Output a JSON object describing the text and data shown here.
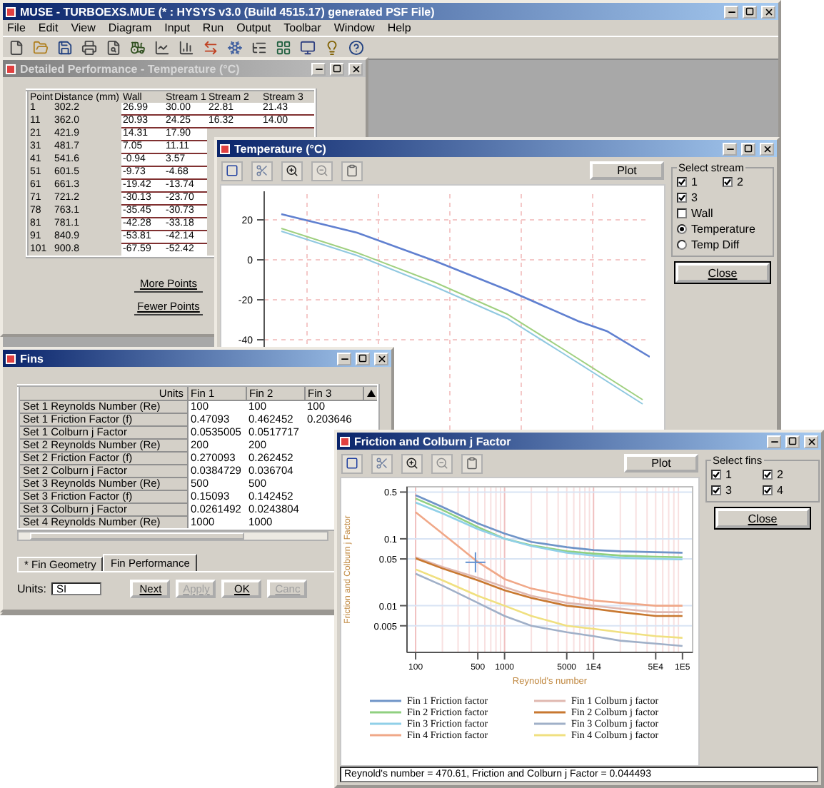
{
  "main_window": {
    "title": "MUSE - TURBOEXS.MUE (* : HYSYS v3.0 (Build 4515.17) generated PSF File)",
    "menu": [
      "File",
      "Edit",
      "View",
      "Diagram",
      "Input",
      "Run",
      "Output",
      "Toolbar",
      "Window",
      "Help"
    ]
  },
  "performance_window": {
    "title": "Detailed Performance - Temperature (°C)",
    "columns": [
      "Point",
      "Distance (mm)",
      "Wall",
      "Stream 1",
      "Stream 2",
      "Stream 3"
    ],
    "rows": [
      [
        "1",
        "302.2",
        "26.99",
        "30.00",
        "22.81",
        "21.43"
      ],
      [
        "11",
        "362.0",
        "20.93",
        "24.25",
        "16.32",
        "14.00"
      ],
      [
        "21",
        "421.9",
        "14.31",
        "17.90"
      ],
      [
        "31",
        "481.7",
        "7.05",
        "11.11"
      ],
      [
        "41",
        "541.6",
        "-0.94",
        "3.57"
      ],
      [
        "51",
        "601.5",
        "-9.73",
        "-4.68"
      ],
      [
        "61",
        "661.3",
        "-19.42",
        "-13.74"
      ],
      [
        "71",
        "721.2",
        "-30.13",
        "-23.70"
      ],
      [
        "78",
        "763.1",
        "-35.45",
        "-30.73"
      ],
      [
        "81",
        "781.1",
        "-42.28",
        "-33.18"
      ],
      [
        "91",
        "840.9",
        "-53.81",
        "-42.14"
      ],
      [
        "101",
        "900.8",
        "-67.59",
        "-52.42"
      ]
    ],
    "buttons": [
      "More Points",
      "Fewer Points"
    ]
  },
  "temperature_window": {
    "title": "Temperature (°C)",
    "plot_button": "Plot",
    "y_ticks": [
      "20",
      "0",
      "-20",
      "-40"
    ],
    "group_title": "Select stream",
    "streams": [
      {
        "label": "1",
        "checked": true
      },
      {
        "label": "2",
        "checked": true
      },
      {
        "label": "3",
        "checked": true
      }
    ],
    "options": [
      {
        "kind": "checkbox",
        "label": "Wall",
        "checked": false
      },
      {
        "kind": "radio",
        "label": "Temperature",
        "selected": true
      },
      {
        "kind": "radio",
        "label": "Temp Diff",
        "selected": false
      }
    ],
    "close_button": "Close"
  },
  "fins_window": {
    "title": "Fins",
    "columns": [
      "Units",
      "Fin 1",
      "Fin 2",
      "Fin 3"
    ],
    "rows": [
      [
        "Set 1 Reynolds Number (Re)",
        "100",
        "100",
        "100"
      ],
      [
        "Set 1 Friction Factor (f)",
        "0.47093",
        "0.462452",
        "0.203646"
      ],
      [
        "Set 1 Colburn j Factor",
        "0.0535005",
        "0.0517717"
      ],
      [
        "Set 2 Reynolds Number (Re)",
        "200",
        "200"
      ],
      [
        "Set 2 Friction Factor (f)",
        "0.270093",
        "0.262452"
      ],
      [
        "Set 2 Colburn j Factor",
        "0.0384729",
        "0.036704"
      ],
      [
        "Set 3 Reynolds Number (Re)",
        "500",
        "500"
      ],
      [
        "Set 3 Friction Factor (f)",
        "0.15093",
        "0.142452"
      ],
      [
        "Set 3 Colburn j Factor",
        "0.0261492",
        "0.0243804"
      ],
      [
        "Set 4 Reynolds Number (Re)",
        "1000",
        "1000"
      ]
    ],
    "tabs": [
      {
        "label": "* Fin Geometry",
        "selected": false
      },
      {
        "label": "Fin Performance",
        "selected": true
      }
    ],
    "units_label": "Units:",
    "units_value": "SI",
    "buttons": [
      {
        "label": "Next",
        "disabled": false
      },
      {
        "label": "Apply",
        "disabled": true
      },
      {
        "label": "OK",
        "disabled": false
      },
      {
        "label": "Canc",
        "disabled": true
      }
    ]
  },
  "friction_window": {
    "title": "Friction and Colburn j Factor",
    "plot_button": "Plot",
    "group_title": "Select fins",
    "fins": [
      {
        "label": "1",
        "checked": true
      },
      {
        "label": "2",
        "checked": true
      },
      {
        "label": "3",
        "checked": true
      },
      {
        "label": "4",
        "checked": true
      }
    ],
    "close_button": "Close",
    "chart": {
      "xlabel": "Reynold's number",
      "ylabel": "Friction and Colburn j Factor",
      "x_ticks": [
        "100",
        "500",
        "1000",
        "5000",
        "1E4",
        "5E4",
        "1E5"
      ],
      "y_ticks": [
        "0.5",
        "0.1",
        "0.05",
        "0.01",
        "0.005"
      ],
      "legend": [
        {
          "label": "Fin 1 Friction factor",
          "color": "#6f94c8"
        },
        {
          "label": "Fin 1 Colburn j factor",
          "color": "#e0b8b0"
        },
        {
          "label": "Fin 2 Friction factor",
          "color": "#90d080"
        },
        {
          "label": "Fin 2 Colburn j factor",
          "color": "#c87830"
        },
        {
          "label": "Fin 3 Friction factor",
          "color": "#90d0e8"
        },
        {
          "label": "Fin 3 Colburn j factor",
          "color": "#a0b0c8"
        },
        {
          "label": "Fin 4 Friction factor",
          "color": "#f0a888"
        },
        {
          "label": "Fin 4 Colburn j factor",
          "color": "#f0e080"
        }
      ]
    },
    "status": "Reynold's number = 470.61, Friction and Colburn j Factor = 0.044493"
  }
}
